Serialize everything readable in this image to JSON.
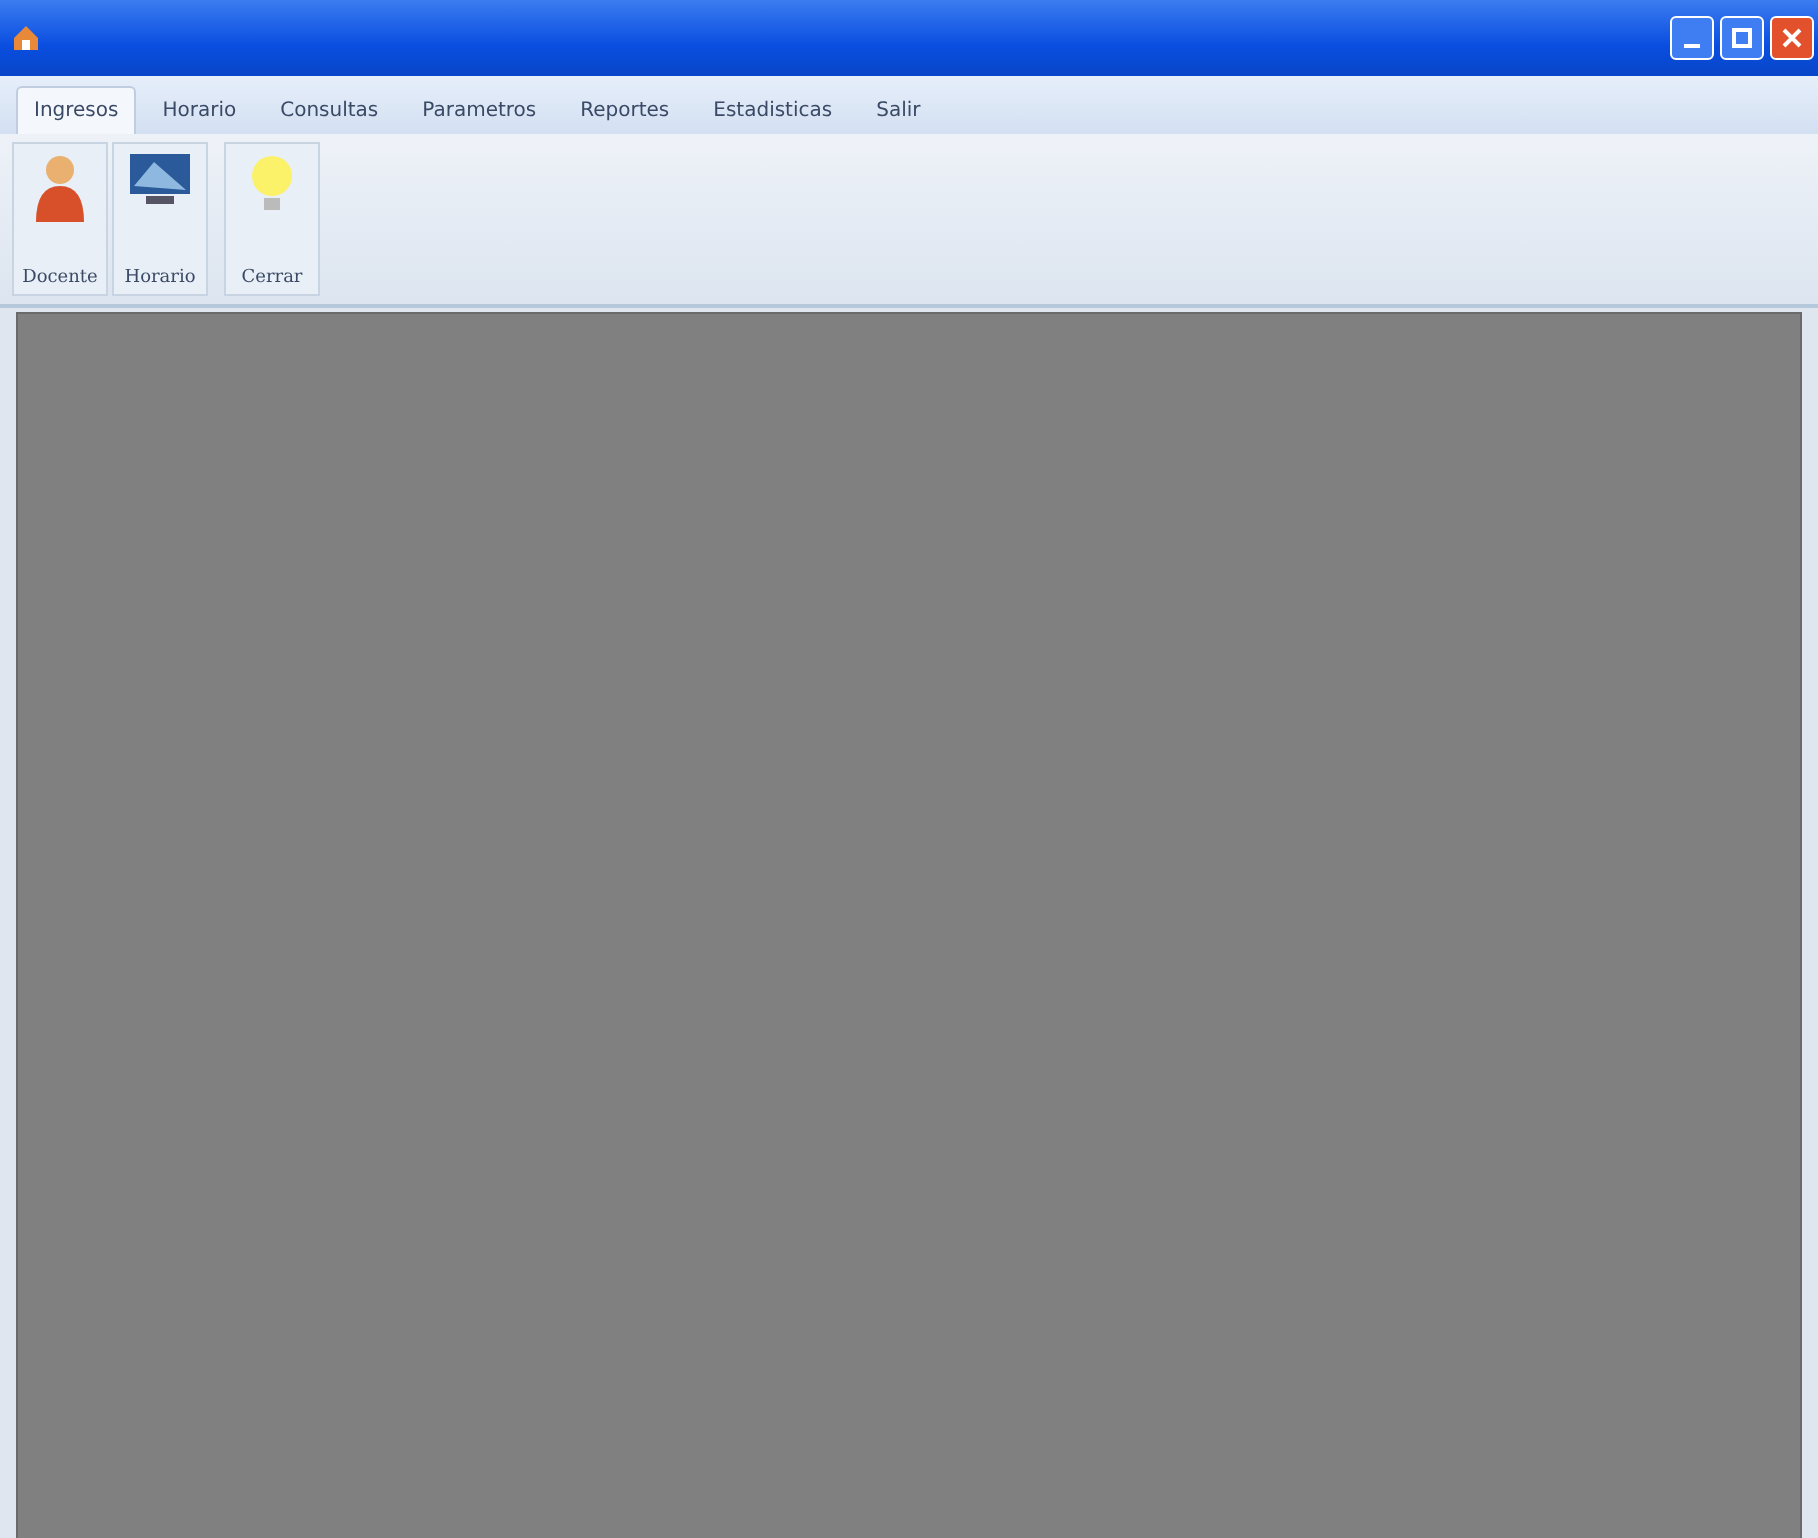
{
  "tabs": [
    {
      "label": "Ingresos",
      "selected": true
    },
    {
      "label": "Horario",
      "selected": false
    },
    {
      "label": "Consultas",
      "selected": false
    },
    {
      "label": "Parametros",
      "selected": false
    },
    {
      "label": "Reportes",
      "selected": false
    },
    {
      "label": "Estadisticas",
      "selected": false
    },
    {
      "label": "Salir",
      "selected": false
    }
  ],
  "ribbon_buttons": [
    {
      "label": "Docente",
      "kind": "person"
    },
    {
      "label": "Horario",
      "kind": "screen"
    },
    {
      "label": "Cerrar",
      "kind": "bulb"
    }
  ]
}
